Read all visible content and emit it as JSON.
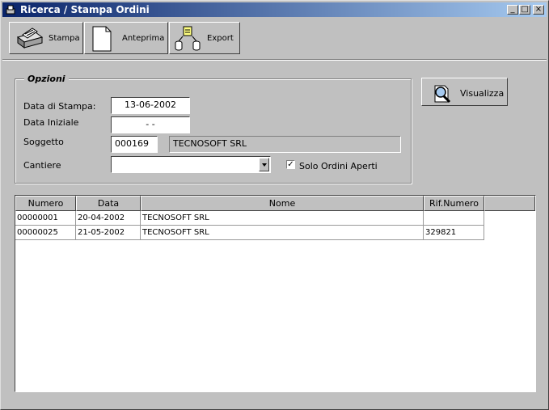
{
  "window": {
    "title": "Ricerca / Stampa Ordini"
  },
  "titlebar_buttons": {
    "minimize": "_",
    "maximize": "□",
    "close": "×"
  },
  "toolbar": {
    "stampa_label": "Stampa",
    "anteprima_label": "Anteprima",
    "export_label": "Export"
  },
  "options": {
    "group_title": "Opzioni",
    "data_stampa_label": "Data di Stampa:",
    "data_stampa_value": "13-06-2002",
    "data_iniziale_label": "Data Iniziale",
    "data_iniziale_value": "-  -",
    "soggetto_label": "Soggetto",
    "soggetto_code": "000169",
    "soggetto_name": "TECNOSOFT SRL",
    "cantiere_label": "Cantiere",
    "cantiere_value": "",
    "solo_aperti_label": "Solo Ordini Aperti",
    "solo_aperti_checked": true,
    "check_mark": "✓"
  },
  "visualizza_label": "Visualizza",
  "grid": {
    "columns": [
      "Numero",
      "Data",
      "Nome",
      "Rif.Numero"
    ],
    "rows": [
      [
        "00000001",
        "20-04-2002",
        "TECNOSOFT SRL",
        ""
      ],
      [
        "00000025",
        "21-05-2002",
        "TECNOSOFT SRL",
        "329821"
      ]
    ]
  },
  "icons": {
    "app": "window-app-icon",
    "stampa": "printer-icon",
    "anteprima": "document-page-icon",
    "export": "export-database-icon",
    "visualizza": "magnifier-document-icon"
  }
}
